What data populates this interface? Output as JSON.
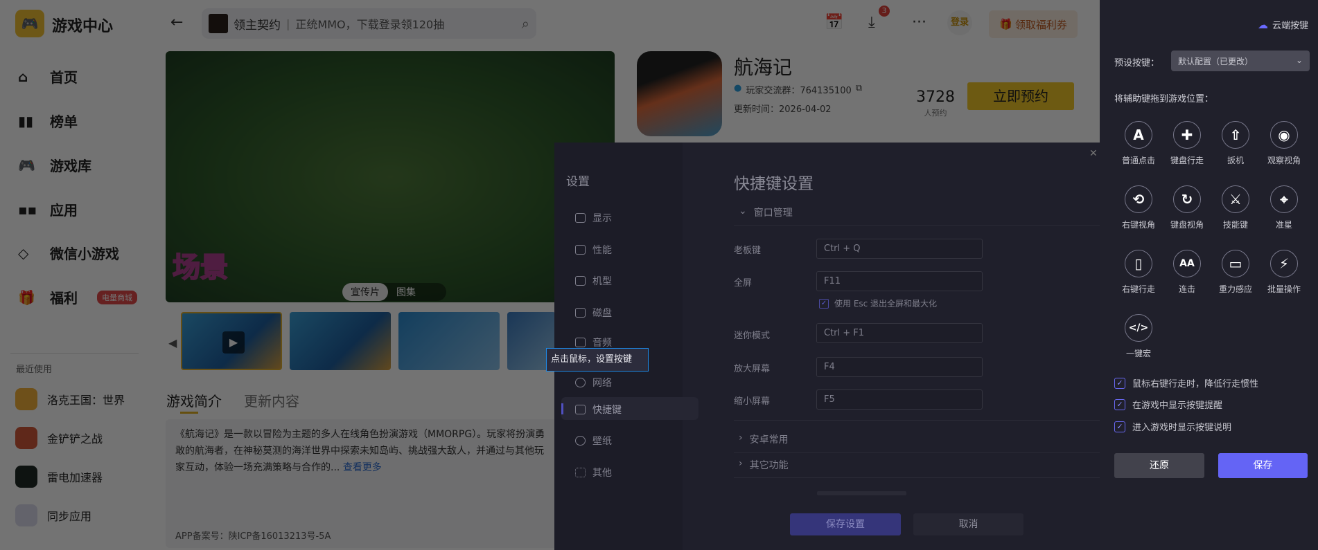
{
  "app": {
    "title": "游戏中心"
  },
  "sidebar": {
    "items": [
      {
        "label": "首页"
      },
      {
        "label": "榜单"
      },
      {
        "label": "游戏库"
      },
      {
        "label": "应用"
      },
      {
        "label": "微信小游戏"
      },
      {
        "label": "福利",
        "badge": "电量商城"
      }
    ],
    "recent_title": "最近使用",
    "recent": [
      {
        "label": "洛克王国：世界"
      },
      {
        "label": "金铲铲之战"
      },
      {
        "label": "雷电加速器"
      },
      {
        "label": "同步应用"
      }
    ]
  },
  "header": {
    "search_game": "领主契约",
    "search_text": "正统MMO，下载登录领120抽",
    "download_badge": "3",
    "login": "登录",
    "coupon": "领取福利券"
  },
  "game": {
    "title": "航海记",
    "group_label": "玩家交流群：764135100",
    "update": "更新时间：2026-04-02",
    "count": "3728",
    "count_label": "人预约",
    "reserve": "立即预约",
    "media_tabs": [
      "宣传片",
      "图集"
    ],
    "tabs": [
      "游戏简介",
      "更新内容"
    ],
    "desc": "《航海记》是一款以冒险为主题的多人在线角色扮演游戏（MMORPG）。玩家将扮演勇敢的航海者，在神秘莫测的海洋世界中探索未知岛屿、挑战强大敌人，并通过与其他玩家互动，体验一场充满策略与合作的...",
    "more": "查看更多",
    "icp": "APP备案号：陕ICP备16013213号-5A",
    "banner_label": "场景"
  },
  "settings": {
    "title": "设置",
    "nav": [
      "显示",
      "性能",
      "机型",
      "磁盘",
      "音频",
      "网络",
      "快捷键",
      "壁纸",
      "其他"
    ],
    "heading": "快捷键设置",
    "section": "窗口管理",
    "rows": [
      {
        "label": "老板键",
        "value": "Ctrl + Q"
      },
      {
        "label": "全屏",
        "value": "F11"
      },
      {
        "label": "迷你模式",
        "value": "Ctrl + F1"
      },
      {
        "label": "放大屏幕",
        "value": "F4"
      },
      {
        "label": "缩小屏幕",
        "value": "F5"
      }
    ],
    "esc_option": "使用 Esc 退出全屏和最大化",
    "sections": [
      "安卓常用",
      "其它功能"
    ],
    "save": "保存设置",
    "cancel": "取消"
  },
  "tooltip": "点击鼠标，设置按键",
  "keypanel": {
    "cloud": "云端按键",
    "preset_label": "预设按键：",
    "preset_value": "默认配置（已更改）",
    "drag_hint": "将辅助键拖到游戏位置：",
    "tools": [
      {
        "label": "普通点击",
        "icon": "A"
      },
      {
        "label": "键盘行走",
        "icon": "✚"
      },
      {
        "label": "扳机",
        "icon": "⇧"
      },
      {
        "label": "观察视角",
        "icon": "◉"
      },
      {
        "label": "右键视角",
        "icon": "⟲"
      },
      {
        "label": "键盘视角",
        "icon": "↻"
      },
      {
        "label": "技能键",
        "icon": "⚔"
      },
      {
        "label": "准星",
        "icon": "⌖"
      },
      {
        "label": "右键行走",
        "icon": "▯"
      },
      {
        "label": "连击",
        "icon": "AA"
      },
      {
        "label": "重力感应",
        "icon": "▭"
      },
      {
        "label": "批量操作",
        "icon": "⚡"
      },
      {
        "label": "一键宏",
        "icon": "</>"
      }
    ],
    "options": [
      "鼠标右键行走时，降低行走惯性",
      "在游戏中显示按键提醒",
      "进入游戏时显示按键说明"
    ],
    "reset": "还原",
    "save": "保存",
    "accent": "#6464f5"
  }
}
